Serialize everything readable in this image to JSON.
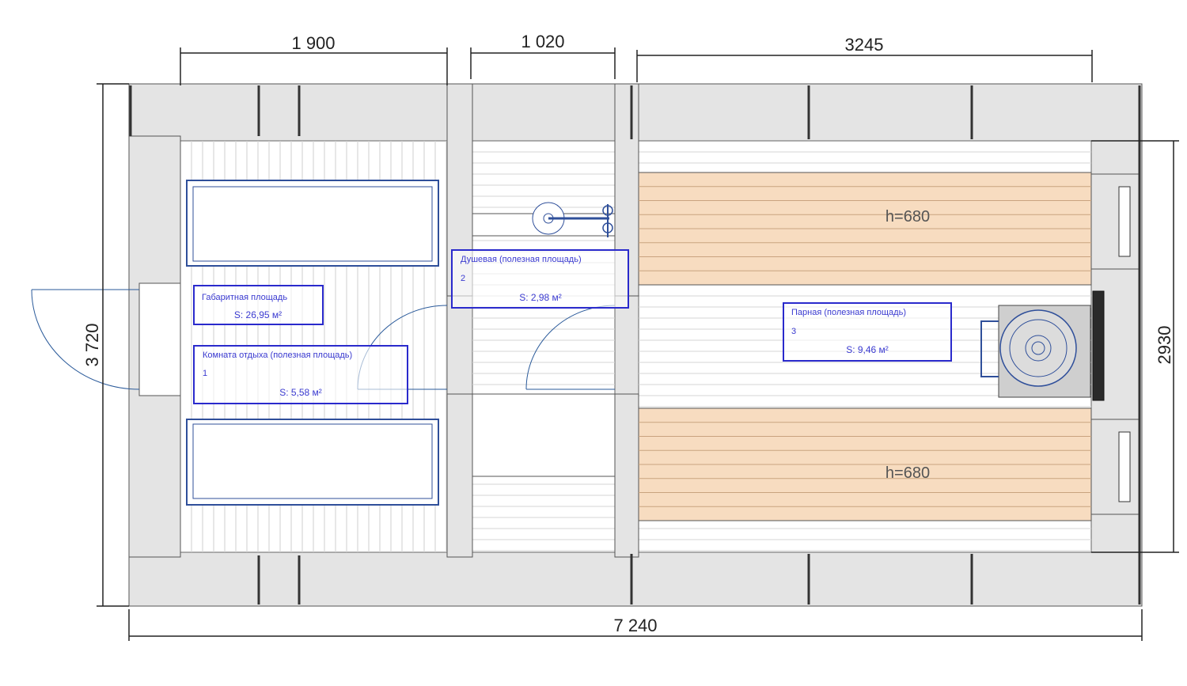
{
  "dimensions": {
    "top_rest": "1 900",
    "top_shower": "1 020",
    "top_steam": "3245",
    "bottom_total": "7 240",
    "left_total": "3 720",
    "right_inner": "2930"
  },
  "rooms": {
    "gross": {
      "name": "Габаритная площадь",
      "area": "S: 26,95 м²"
    },
    "rest": {
      "name": "Комната отдыха (полезная площадь)",
      "number": "1",
      "area": "S: 5,58 м²"
    },
    "shower": {
      "name": "Душевая (полезная площадь)",
      "number": "2",
      "area": "S: 2,98 м²"
    },
    "steam": {
      "name": "Парная (полезная площадь)",
      "number": "3",
      "area": "S: 9,46 м²"
    }
  },
  "benches": {
    "upper": "h=680",
    "lower": "h=680"
  },
  "colors": {
    "wall": "#e4e4e4",
    "bench": "#f7dcc0",
    "label_border": "#2a2acc",
    "furniture": "#2f4f9a"
  }
}
